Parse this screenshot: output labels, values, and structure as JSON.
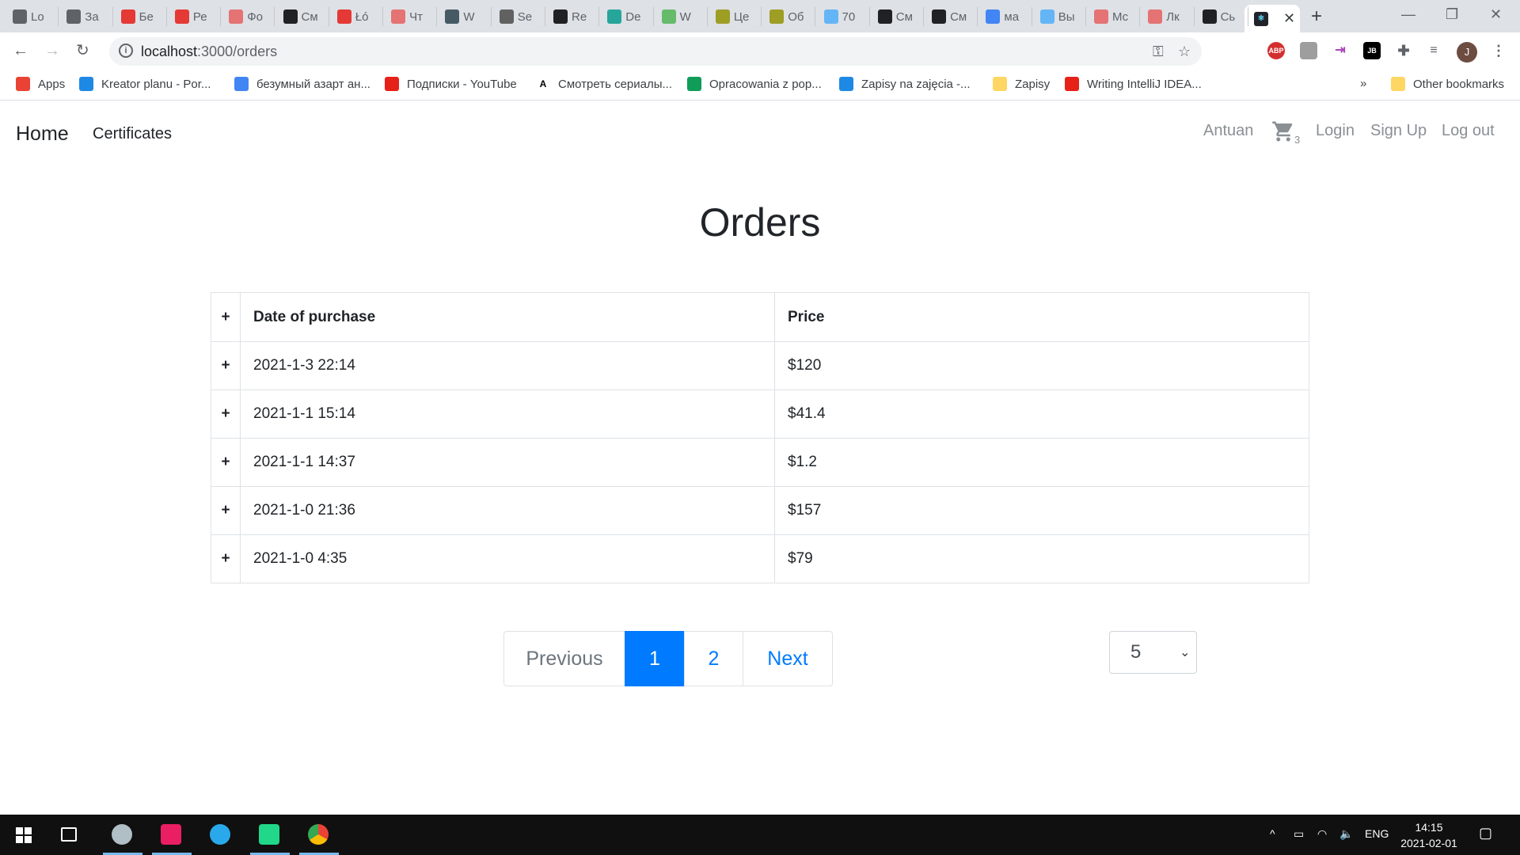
{
  "browser": {
    "tabs": [
      {
        "label": "Lo",
        "icon": "globe-icon",
        "color": "#5f6368"
      },
      {
        "label": "За",
        "icon": "avatar-icon",
        "color": "#5f6368"
      },
      {
        "label": "Бе",
        "icon": "tur-icon",
        "color": "#e53935"
      },
      {
        "label": "Ре",
        "icon": "tur-icon",
        "color": "#e53935"
      },
      {
        "label": "Фо",
        "icon": "puzzle-icon",
        "color": "#e57373"
      },
      {
        "label": "См",
        "icon": "hd-icon",
        "color": "#202124"
      },
      {
        "label": "Łó",
        "icon": "flag-icon",
        "color": "#e53935"
      },
      {
        "label": "Чт",
        "icon": "arrow-icon",
        "color": "#e57373"
      },
      {
        "label": "W",
        "icon": "k-icon",
        "color": "#455a64"
      },
      {
        "label": "Se",
        "icon": "io-icon",
        "color": "#616161"
      },
      {
        "label": "Re",
        "icon": "camera-icon",
        "color": "#202124"
      },
      {
        "label": "De",
        "icon": "react-icon",
        "color": "#26a69a"
      },
      {
        "label": "W",
        "icon": "w-icon",
        "color": "#66bb6a"
      },
      {
        "label": "Це",
        "icon": "coin-icon",
        "color": "#9e9d24"
      },
      {
        "label": "Об",
        "icon": "coin-icon",
        "color": "#9e9d24"
      },
      {
        "label": "70",
        "icon": "snow-icon",
        "color": "#64b5f6"
      },
      {
        "label": "См",
        "icon": "hd-icon",
        "color": "#202124"
      },
      {
        "label": "См",
        "icon": "hd-icon",
        "color": "#202124"
      },
      {
        "label": "ма",
        "icon": "google-icon",
        "color": "#4285f4"
      },
      {
        "label": "Вы",
        "icon": "snow-icon",
        "color": "#64b5f6"
      },
      {
        "label": "Мс",
        "icon": "t-icon",
        "color": "#e57373"
      },
      {
        "label": "Лк",
        "icon": "t-icon",
        "color": "#e57373"
      },
      {
        "label": "Сь",
        "icon": "lf-icon",
        "color": "#202124"
      }
    ],
    "active_tab_icon": "react-icon",
    "url_host": "localhost",
    "url_path": ":3000/orders",
    "bookmarks": [
      {
        "label": "Apps",
        "icon": "apps-grid-icon",
        "color": "#ea4335"
      },
      {
        "label": "Kreator planu - Por...",
        "icon": "usos-icon",
        "color": "#1e88e5"
      },
      {
        "label": "безумный азарт ан...",
        "icon": "google-icon",
        "color": "#4285f4"
      },
      {
        "label": "Подписки - YouTube",
        "icon": "youtube-icon",
        "color": "#e62117"
      },
      {
        "label": "Смотреть сериалы...",
        "icon": "a-icon",
        "color": "#000000"
      },
      {
        "label": "Opracowania z pop...",
        "icon": "drive-icon",
        "color": "#0f9d58"
      },
      {
        "label": "Zapisy na zajęcia -...",
        "icon": "usos-icon",
        "color": "#1e88e5"
      },
      {
        "label": "Zapisy",
        "icon": "folder-icon",
        "color": "#fdd663"
      },
      {
        "label": "Writing IntelliJ IDEA...",
        "icon": "youtube-icon",
        "color": "#e62117"
      }
    ],
    "more_bookmarks": "»",
    "other_bookmarks": "Other bookmarks",
    "profile_initial": "J"
  },
  "app": {
    "nav": {
      "home": "Home",
      "certificates": "Certificates",
      "user": "Antuan",
      "cart_count": "3",
      "login": "Login",
      "signup": "Sign Up",
      "logout": "Log out"
    },
    "title": "Orders",
    "table": {
      "expand_symbol": "+",
      "columns": [
        "Date of purchase",
        "Price"
      ],
      "rows": [
        {
          "date": "2021-1-3 22:14",
          "price": "$120"
        },
        {
          "date": "2021-1-1 15:14",
          "price": "$41.4"
        },
        {
          "date": "2021-1-1 14:37",
          "price": "$1.2"
        },
        {
          "date": "2021-1-0 21:36",
          "price": "$157"
        },
        {
          "date": "2021-1-0 4:35",
          "price": "$79"
        }
      ]
    },
    "pagination": {
      "previous": "Previous",
      "pages": [
        "1",
        "2"
      ],
      "current": "1",
      "next": "Next"
    },
    "page_size": "5"
  },
  "taskbar": {
    "language": "ENG",
    "time": "14:15",
    "date": "2021-02-01"
  },
  "colors": {
    "primary": "#007bff",
    "text": "#212529",
    "muted": "#8a8f94"
  }
}
